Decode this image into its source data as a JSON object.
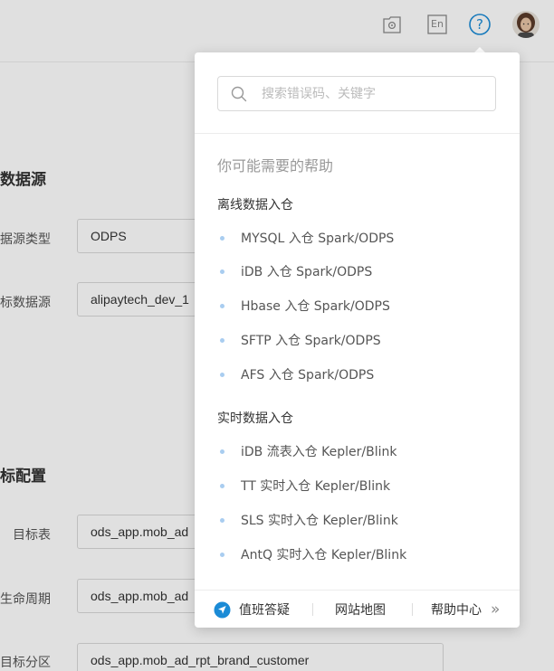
{
  "header": {
    "icons": [
      "settings-box-icon",
      "language-en-icon",
      "help-question-icon",
      "user-avatar"
    ],
    "lang_label": "En",
    "help_label": "?"
  },
  "form": {
    "section1_title": "数据源",
    "source_type_label": "据源类型",
    "source_type_value": "ODPS",
    "target_source_label": "标数据源",
    "target_source_value": "alipaytech_dev_1",
    "section2_title": "标配置",
    "target_table_label": "目标表",
    "target_table_value": "ods_app.mob_ad",
    "lifecycle_label": "生命周期",
    "lifecycle_value": "ods_app.mob_ad",
    "partition_label": "目标分区",
    "partition_value": "ods_app.mob_ad_rpt_brand_customer"
  },
  "popover": {
    "search_placeholder": "搜索错误码、关键字",
    "title": "你可能需要的帮助",
    "groups": [
      {
        "title": "离线数据入仓",
        "items": [
          "MYSQL 入仓 Spark/ODPS",
          "iDB 入仓 Spark/ODPS",
          "Hbase 入仓 Spark/ODPS",
          "SFTP 入仓 Spark/ODPS",
          "AFS 入仓 Spark/ODPS"
        ]
      },
      {
        "title": "实时数据入仓",
        "items": [
          "iDB 流表入仓 Kepler/Blink",
          "TT 实时入仓 Kepler/Blink",
          "SLS 实时入仓 Kepler/Blink",
          "AntQ 实时入仓 Kepler/Blink"
        ]
      }
    ],
    "footer": {
      "duty_label": "值班答疑",
      "sitemap_label": "网站地图",
      "help_center_label": "帮助中心",
      "more_glyph": "»"
    }
  },
  "colors": {
    "accent": "#1b8bd6",
    "dot": "#a9cdf0",
    "overlay": "rgba(0,0,0,0.12)"
  }
}
